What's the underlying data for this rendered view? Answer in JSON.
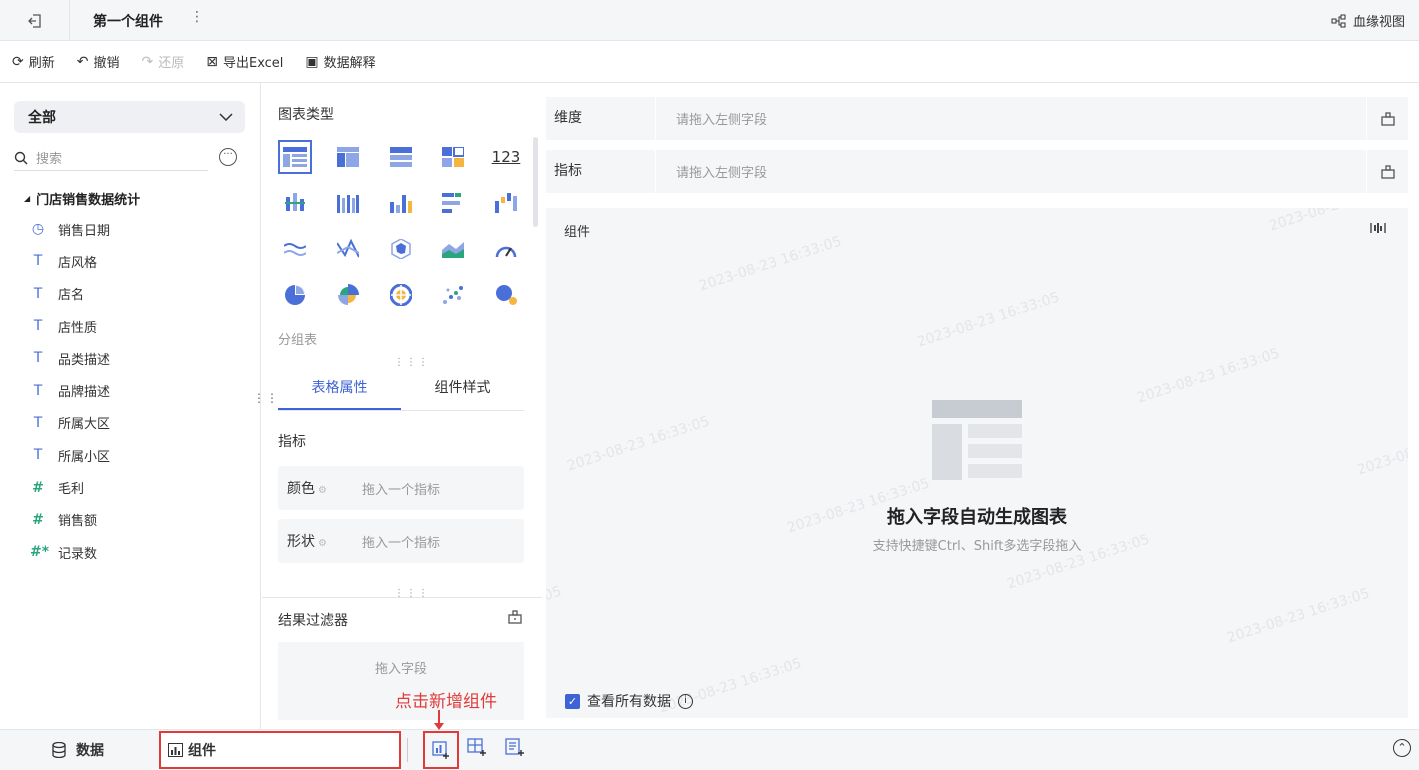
{
  "topbar": {
    "title": "第一个组件",
    "more": "⋮",
    "lineage_label": "血缘视图"
  },
  "toolbar": {
    "refresh": "刷新",
    "undo": "撤销",
    "redo": "还原",
    "export": "导出Excel",
    "explain": "数据解释"
  },
  "left": {
    "dataset_select": "全部",
    "search_placeholder": "搜索",
    "tree_title": "门店销售数据统计",
    "fields": [
      {
        "type": "date",
        "icon": "◷",
        "label": "销售日期"
      },
      {
        "type": "dim",
        "icon": "T",
        "label": "店风格"
      },
      {
        "type": "dim",
        "icon": "T",
        "label": "店名"
      },
      {
        "type": "dim",
        "icon": "T",
        "label": "店性质"
      },
      {
        "type": "dim",
        "icon": "T",
        "label": "品类描述"
      },
      {
        "type": "dim",
        "icon": "T",
        "label": "品牌描述"
      },
      {
        "type": "dim",
        "icon": "T",
        "label": "所属大区"
      },
      {
        "type": "dim",
        "icon": "T",
        "label": "所属小区"
      },
      {
        "type": "mea",
        "icon": "#",
        "label": "毛利"
      },
      {
        "type": "mea",
        "icon": "#",
        "label": "销售额"
      },
      {
        "type": "mea",
        "icon": "#*",
        "label": "记录数"
      }
    ]
  },
  "mid": {
    "chart_type_title": "图表类型",
    "chart_rows": [
      [
        "detail-table-icon",
        "cross-table-icon",
        "group-table-icon",
        "kpi-card-icon",
        "number-card-icon"
      ],
      [
        "stacked-bar-icon",
        "multi-bar-icon",
        "bar-chart-icon",
        "horizontal-bar-icon",
        "waterfall-icon"
      ],
      [
        "line-chart-icon",
        "radar-line-icon",
        "radar-icon",
        "area-chart-icon",
        "gauge-icon"
      ],
      [
        "pie-chart-icon",
        "rose-chart-icon",
        "sunburst-icon",
        "scatter-icon",
        "bubble-icon"
      ]
    ],
    "number_card_text": "123",
    "selected_chart_label": "分组表",
    "tabs": [
      "表格属性",
      "组件样式"
    ],
    "indicator_section": "指标",
    "color_label": "颜色",
    "color_placeholder": "拖入一个指标",
    "shape_label": "形状",
    "shape_placeholder": "拖入一个指标",
    "filter_title": "结果过滤器",
    "filter_placeholder": "拖入字段"
  },
  "right": {
    "dimension_label": "维度",
    "dimension_placeholder": "请拖入左侧字段",
    "measure_label": "指标",
    "measure_placeholder": "请拖入左侧字段",
    "canvas_label": "组件",
    "watermark": "2023-08-23 16:33:05",
    "empty_title": "拖入字段自动生成图表",
    "empty_subtitle": "支持快捷键Ctrl、Shift多选字段拖入",
    "view_all_label": "查看所有数据",
    "view_all_checked": true
  },
  "bottombar": {
    "data_tab": "数据",
    "component_tab": "组件"
  },
  "annotation": {
    "text": "点击新增组件"
  },
  "colors": {
    "accent": "#3d63d6",
    "annotation": "#e03a3a",
    "measure": "#2aa57f"
  }
}
